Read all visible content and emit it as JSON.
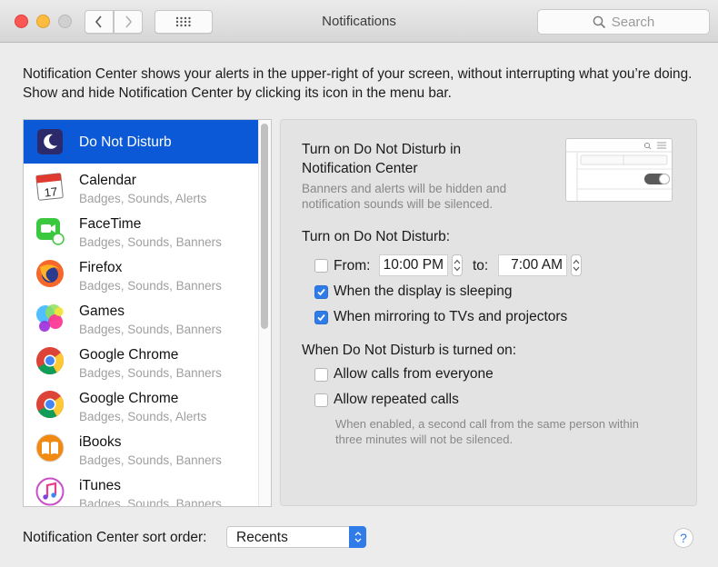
{
  "window": {
    "title": "Notifications",
    "search_placeholder": "Search"
  },
  "intro_text": "Notification Center shows your alerts in the upper-right of your screen, without interrupting what you’re doing. Show and hide Notification Center by clicking its icon in the menu bar.",
  "sidebar": {
    "items": [
      {
        "name": "Do Not Disturb",
        "subtitle": "",
        "icon": "moon-icon",
        "selected": true
      },
      {
        "name": "Calendar",
        "subtitle": "Badges, Sounds, Alerts",
        "icon": "calendar-icon",
        "icon_text": "17",
        "icon_month": "JUL"
      },
      {
        "name": "FaceTime",
        "subtitle": "Badges, Sounds, Banners",
        "icon": "facetime-icon"
      },
      {
        "name": "Firefox",
        "subtitle": "Badges, Sounds, Banners",
        "icon": "firefox-icon"
      },
      {
        "name": "Games",
        "subtitle": "Badges, Sounds, Banners",
        "icon": "game-center-icon"
      },
      {
        "name": "Google Chrome",
        "subtitle": "Badges, Sounds, Banners",
        "icon": "chrome-icon"
      },
      {
        "name": "Google Chrome",
        "subtitle": "Badges, Sounds, Alerts",
        "icon": "chrome-icon"
      },
      {
        "name": "iBooks",
        "subtitle": "Badges, Sounds, Banners",
        "icon": "ibooks-icon"
      },
      {
        "name": "iTunes",
        "subtitle": "Badges, Sounds, Banners",
        "icon": "itunes-icon"
      }
    ]
  },
  "dnd": {
    "nc_heading_line1": "Turn on Do Not Disturb in",
    "nc_heading_line2": "Notification Center",
    "nc_desc_line1": "Banners and alerts will be hidden and",
    "nc_desc_line2": "notification sounds will be silenced.",
    "turn_on_heading": "Turn on Do Not Disturb:",
    "from_label": "From:",
    "from_checked": false,
    "from_time": "10:00 PM",
    "to_label": "to:",
    "to_time": "7:00 AM",
    "display_sleeping_label": "When the display is sleeping",
    "display_sleeping_checked": true,
    "mirroring_label": "When mirroring to TVs and projectors",
    "mirroring_checked": true,
    "when_on_heading": "When Do Not Disturb is turned on:",
    "allow_everyone_label": "Allow calls from everyone",
    "allow_everyone_checked": false,
    "allow_repeated_label": "Allow repeated calls",
    "allow_repeated_checked": false,
    "repeated_desc_line1": "When enabled, a second call from the same person within",
    "repeated_desc_line2": "three minutes will not be silenced."
  },
  "footer": {
    "sort_label": "Notification Center sort order:",
    "sort_value": "Recents",
    "help_label": "?"
  },
  "colors": {
    "selection": "#0b59d6",
    "accent": "#2f7ce8"
  }
}
